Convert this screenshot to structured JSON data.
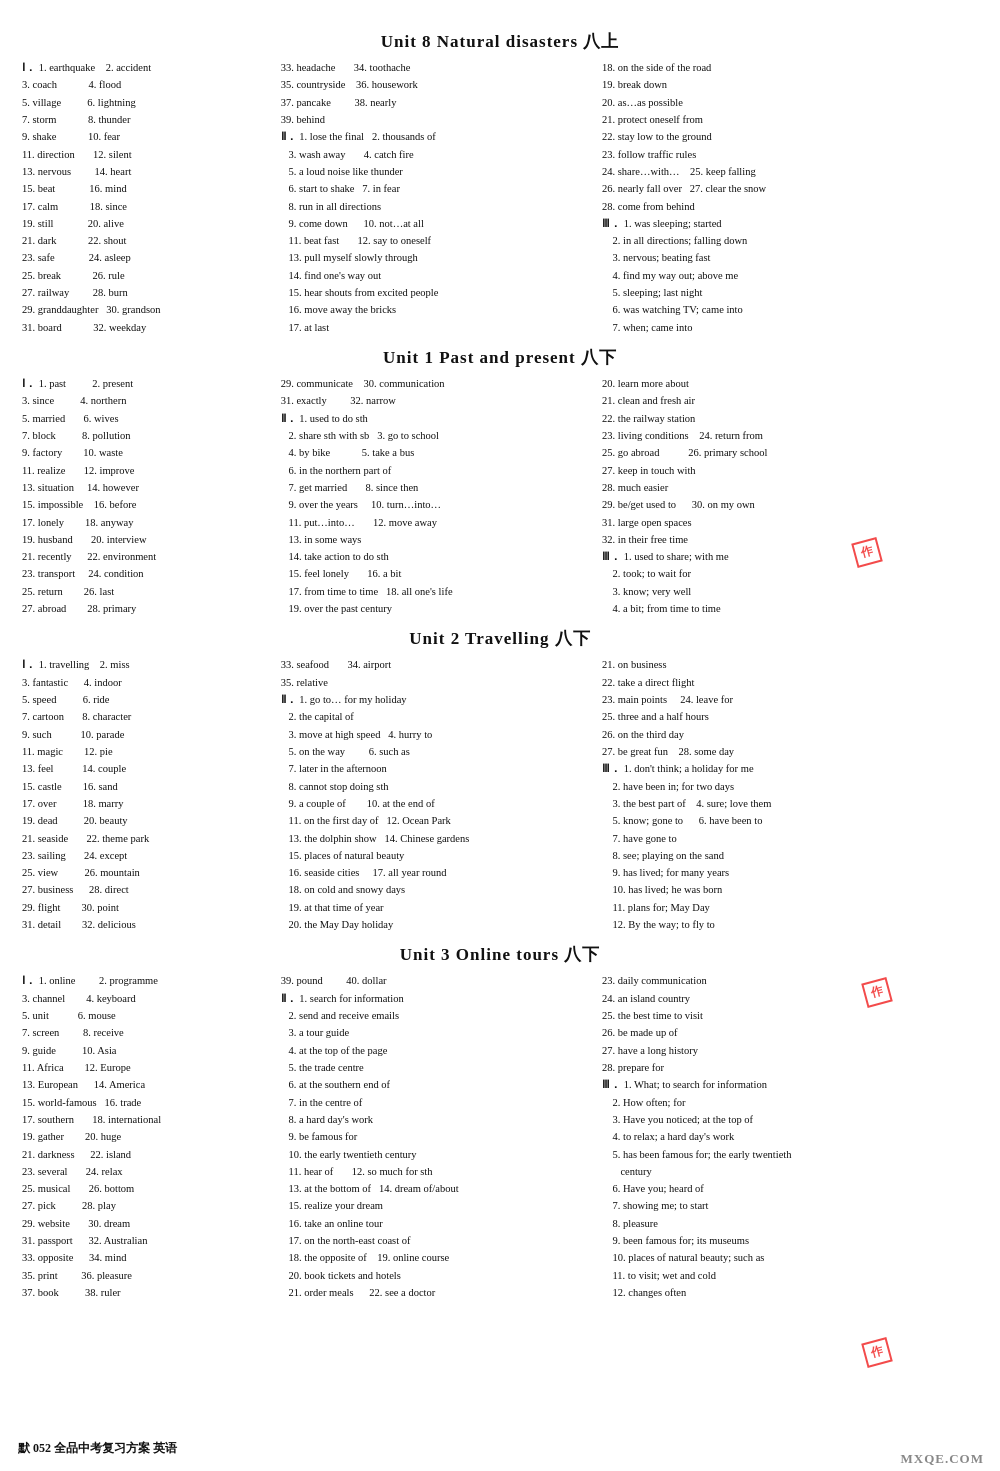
{
  "units": {
    "unit8": {
      "title": "Unit 8   Natural disasters  八上",
      "items_left": [
        "Ⅰ. 1. earthquake   2. accident",
        "3. coach   4. flood",
        "5. village   6. lightning",
        "7. storm   8. thunder",
        "9. shake   10. fear",
        "11. direction   12. silent",
        "13. nervous   14. heart",
        "15. beat   16. mind",
        "17. calm   18. since",
        "19. still   20. alive",
        "21. dark   22. shout",
        "23. safe   24. asleep",
        "25. break   26. rule",
        "27. railway   28. burn",
        "29. granddaughter   30. grandson",
        "31. board   32. weekday"
      ]
    },
    "unit1": {
      "title": "Unit 1   Past and present  八下"
    },
    "unit2": {
      "title": "Unit 2   Travelling 八下"
    },
    "unit3": {
      "title": "Unit 3   Online tours 八下"
    }
  },
  "footer": {
    "page_label": "默 052  全品中考复习方案  英语",
    "book_title": "",
    "watermark": "MXQE.COM"
  }
}
